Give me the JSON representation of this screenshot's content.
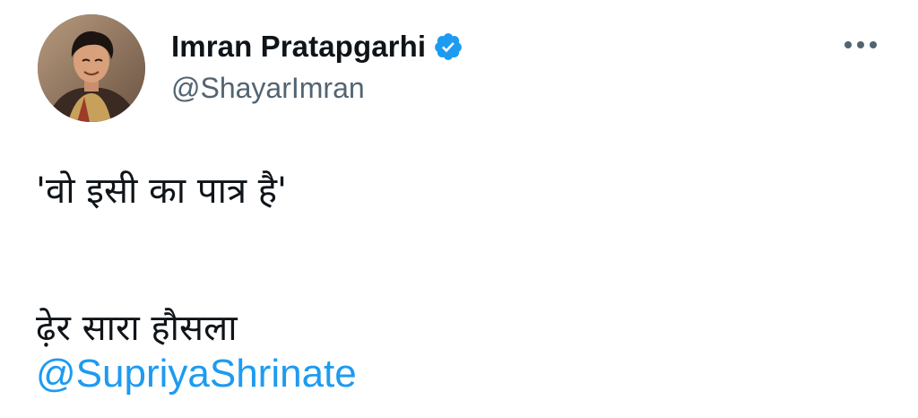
{
  "author": {
    "name": "Imran Pratapgarhi",
    "handle": "@ShayarImran",
    "verified_icon": "verified-badge-icon",
    "avatar": "avatar-photo"
  },
  "more_icon": "more-horizontal-icon",
  "tweet": {
    "line_1": "'वो इसी का पात्र है'",
    "line_2": "ढ़ेर सारा हौसला",
    "mention": "@SupriyaShrinate"
  },
  "colors": {
    "text": "#0f1419",
    "secondary_text": "#536471",
    "link": "#1d9bf0",
    "verified": "#1d9bf0",
    "background": "#ffffff"
  }
}
